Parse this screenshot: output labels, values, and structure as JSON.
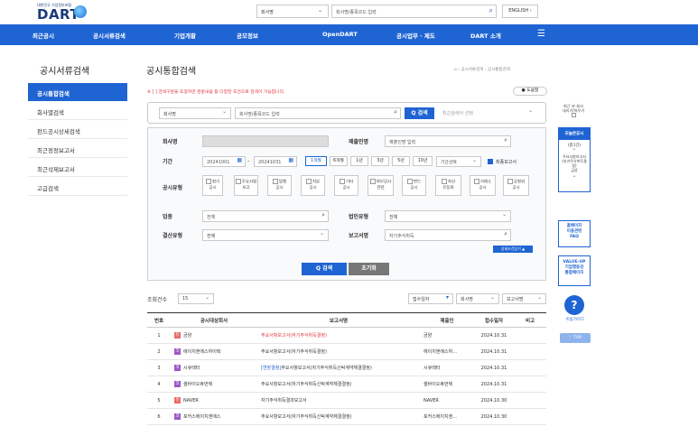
{
  "header": {
    "logo_small": "대한민국 기업정보포털",
    "logo": "DART",
    "top_select": "회사명",
    "top_search_placeholder": "회사명/종목코드 입력",
    "english_btn": "ENGLISH ›"
  },
  "nav": [
    "최근공시",
    "공시서류검색",
    "기업개황",
    "공모정보",
    "OpenDART",
    "공시업무 · 제도",
    "DART 소개"
  ],
  "sidebar": {
    "title": "공시서류검색",
    "items": [
      {
        "label": "공시통합검색",
        "active": true
      },
      {
        "label": "회사별검색"
      },
      {
        "label": "펀드공시상세검색"
      },
      {
        "label": "최근정정보고서"
      },
      {
        "label": "최근삭제보고서"
      },
      {
        "label": "고급검색"
      }
    ]
  },
  "main": {
    "title": "공시통합검색",
    "breadcrumb": "⌂ › 공시서류검색 › 공시통합검색",
    "notice": "※ [ ] 검색구분을 조정하면 분문내용 등 다양한 조건으로 검색이 가능합니다.",
    "help": "● 도움말",
    "search": {
      "select": "회사명",
      "input": "회사명/종목코드 입력",
      "button": "Q 검색",
      "history_select": "최근검색어 선택"
    },
    "filters": {
      "company_label": "회사명",
      "submitter_label": "제출인명",
      "submitter_placeholder": "제출인명 입력",
      "period_label": "기간",
      "date_from": "20241001",
      "date_to": "20241031",
      "period_buttons": [
        "1개월",
        "6개월",
        "1년",
        "3년",
        "5년",
        "10년"
      ],
      "period_select": "기간선택",
      "final_report": "최종보고서",
      "type_label": "공시유형",
      "types": [
        "정기\n공시",
        "주요사항\n보고",
        "발행\n공시",
        "지분\n공시",
        "기타\n공시",
        "외부감사\n관련",
        "펀드\n공시",
        "자산\n유동화",
        "거래소\n공시",
        "공정위\n공시"
      ],
      "industry_label": "업종",
      "industry_value": "전체",
      "corp_type_label": "법인유형",
      "corp_type_value": "전체",
      "settle_label": "결산유형",
      "settle_value": "전체",
      "report_label": "보고서명",
      "report_placeholder": "자기주식취득",
      "more_options": "상세조건닫기 ▲",
      "search_btn": "Q 검색",
      "reset_btn": "초기화"
    },
    "results": {
      "count_label": "조회건수",
      "count_value": "15",
      "sort1": "접수일자",
      "sort2": "회사명",
      "sort3": "보고서명",
      "columns": [
        "번호",
        "공시대상회사",
        "보고서명",
        "제출인",
        "접수일자",
        "비고"
      ],
      "rows": [
        {
          "no": "1",
          "badge": "유",
          "badge_color": "#e86a6a",
          "company": "금양",
          "report": "주요사항보고서(자기주식취득결정)",
          "report_color": "red",
          "submitter": "금양",
          "date": "2024.10.31"
        },
        {
          "no": "2",
          "badge": "코",
          "badge_color": "#9a59c9",
          "company": "에이치엔에스하이텍",
          "report": "주요사항보고서(자기주식취득결정)",
          "report_color": "",
          "submitter": "에이치엔에스하...",
          "date": "2024.10.31"
        },
        {
          "no": "3",
          "badge": "코",
          "badge_color": "#9a59c9",
          "company": "시큐레터",
          "report": "[연장결정]주요사항보고서(자기주식취득신탁계약체결결정)",
          "report_color": "mix",
          "submitter": "시큐레터",
          "date": "2024.10.31"
        },
        {
          "no": "4",
          "badge": "코",
          "badge_color": "#9a59c9",
          "company": "셀바이오휴먼텍",
          "report": "주요사항보고서(자기주식취득신탁계약체결결정)",
          "report_color": "",
          "submitter": "셀바이오휴먼텍",
          "date": "2024.10.31"
        },
        {
          "no": "5",
          "badge": "유",
          "badge_color": "#e86a6a",
          "company": "NAVER",
          "report": "자기주식취득결과보고서",
          "report_color": "",
          "submitter": "NAVER",
          "date": "2024.10.30"
        },
        {
          "no": "6",
          "badge": "코",
          "badge_color": "#9a59c9",
          "company": "포커스에이치엔에스",
          "report": "주요사항보고서(자기주식취득신탁계약체결결정)",
          "report_color": "",
          "submitter": "포커스에이치엔...",
          "date": "2024.10.30"
        }
      ]
    }
  },
  "rail": {
    "viewed": "최근 본 회사\n내리기/띄우기",
    "today_header": "오늘본공시",
    "today_count": "(총1건)",
    "today_item": "주요사항보고서(자기주식취득결정)\n금양",
    "box1": "홈페이지\n이용관련\nFAQ",
    "box2": "VALUE-UP\n기업행동강\n통합페이지",
    "guide": "이용가이드",
    "top": "⌃ TOP"
  }
}
